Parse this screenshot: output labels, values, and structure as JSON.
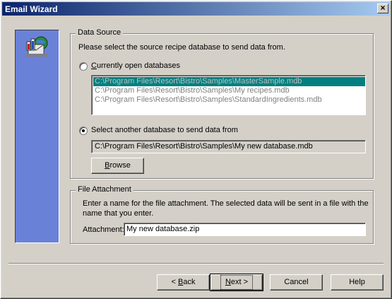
{
  "window": {
    "title": "Email Wizard",
    "close_glyph": "×"
  },
  "icons": {
    "close": "close-icon",
    "wizard": "database-email-icon"
  },
  "data_source": {
    "group_label": "Data Source",
    "instruction": "Please select the source recipe database to send data from.",
    "option_open": {
      "label_pre": "",
      "label_ul": "C",
      "label_post": "urrently open databases",
      "selected": false
    },
    "open_databases": [
      "C:\\Program Files\\Resort\\Bistro\\Samples\\MasterSample.mdb",
      "C:\\Program Files\\Resort\\Bistro\\Samples\\My recipes.mdb",
      "C:\\Program Files\\Resort\\Bistro\\Samples\\StandardIngredients.mdb"
    ],
    "option_other": {
      "label": "Select another database to send data from",
      "selected": true
    },
    "selected_path": "C:\\Program Files\\Resort\\Bistro\\Samples\\My new database.mdb",
    "browse": {
      "ul": "B",
      "rest": "rowse"
    }
  },
  "file_attachment": {
    "group_label": "File Attachment",
    "instruction_line1": "Enter a name for the file attachment.  The selected data will be sent in a file with the",
    "instruction_line2": "name that you enter.",
    "attachment_label": "Attachment:",
    "attachment_value": "My new database.zip"
  },
  "buttons": {
    "back": {
      "pre": "< ",
      "ul": "B",
      "rest": "ack"
    },
    "next": {
      "ul": "N",
      "rest": "ext >"
    },
    "cancel": "Cancel",
    "help": "Help"
  },
  "colors": {
    "title_gradient_start": "#0a246a",
    "title_gradient_end": "#a6caf0",
    "sidebar": "#6a81d8",
    "list_selection": "#008080"
  }
}
